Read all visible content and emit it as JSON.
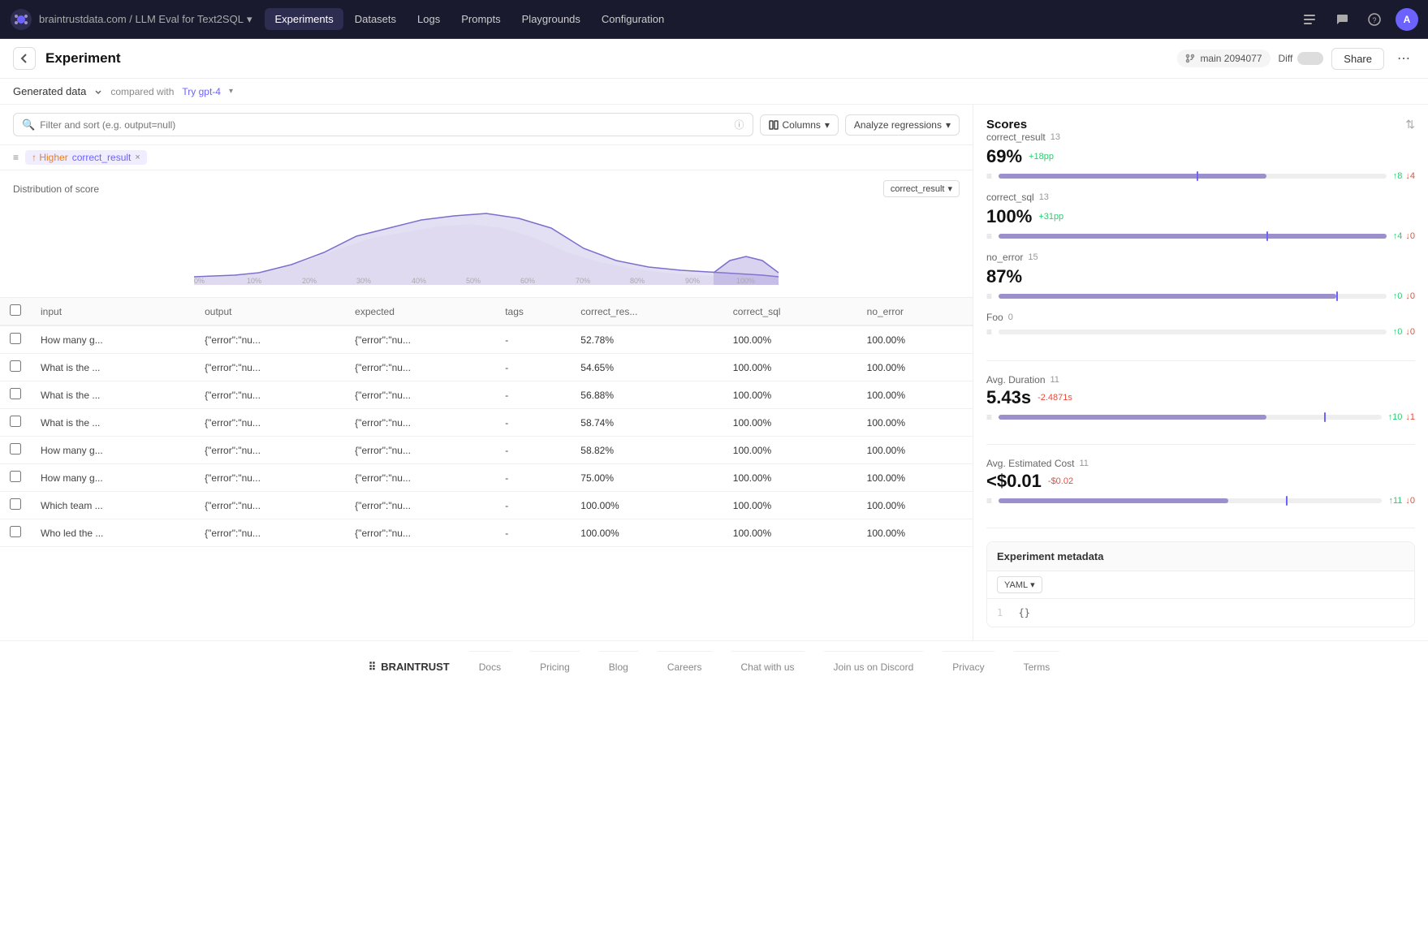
{
  "nav": {
    "logo_text": "B",
    "breadcrumb": "braintrustdata.com / LLM Eval for Text2SQL",
    "items": [
      {
        "label": "Experiments",
        "active": true
      },
      {
        "label": "Datasets",
        "active": false
      },
      {
        "label": "Logs",
        "active": false
      },
      {
        "label": "Prompts",
        "active": false
      },
      {
        "label": "Playgrounds",
        "active": false
      },
      {
        "label": "Configuration",
        "active": false
      }
    ]
  },
  "page": {
    "title": "Experiment",
    "back_label": "←",
    "data_label": "Generated data",
    "compared_with_label": "compared with",
    "compared_link": "Try gpt-4",
    "branch": "main 2094077",
    "diff_label": "Diff",
    "share_label": "Share",
    "more_label": "⋯"
  },
  "filters": {
    "search_placeholder": "Filter and sort (e.g. output=null)",
    "columns_label": "Columns",
    "analyze_label": "Analyze regressions",
    "active_filter": "Higher correct_result",
    "filter_icon": "≡"
  },
  "chart": {
    "title": "Distribution of score",
    "metric_label": "correct_result",
    "x_labels": [
      "0%",
      "10%",
      "20%",
      "30%",
      "40%",
      "50%",
      "60%",
      "70%",
      "80%",
      "90%",
      "100%"
    ]
  },
  "table": {
    "columns": [
      "input",
      "output",
      "expected",
      "tags",
      "correct_res...",
      "correct_sql",
      "no_error"
    ],
    "rows": [
      {
        "input": "How many g...",
        "output": "{\"error\":\"nu...",
        "expected": "{\"error\":\"nu...",
        "tags": "-",
        "correct_result": "52.78%",
        "correct_sql": "100.00%",
        "no_error": "100.00%"
      },
      {
        "input": "What is the ...",
        "output": "{\"error\":\"nu...",
        "expected": "{\"error\":\"nu...",
        "tags": "-",
        "correct_result": "54.65%",
        "correct_sql": "100.00%",
        "no_error": "100.00%"
      },
      {
        "input": "What is the ...",
        "output": "{\"error\":\"nu...",
        "expected": "{\"error\":\"nu...",
        "tags": "-",
        "correct_result": "56.88%",
        "correct_sql": "100.00%",
        "no_error": "100.00%"
      },
      {
        "input": "What is the ...",
        "output": "{\"error\":\"nu...",
        "expected": "{\"error\":\"nu...",
        "tags": "-",
        "correct_result": "58.74%",
        "correct_sql": "100.00%",
        "no_error": "100.00%"
      },
      {
        "input": "How many g...",
        "output": "{\"error\":\"nu...",
        "expected": "{\"error\":\"nu...",
        "tags": "-",
        "correct_result": "58.82%",
        "correct_sql": "100.00%",
        "no_error": "100.00%"
      },
      {
        "input": "How many g...",
        "output": "{\"error\":\"nu...",
        "expected": "{\"error\":\"nu...",
        "tags": "-",
        "correct_result": "75.00%",
        "correct_sql": "100.00%",
        "no_error": "100.00%"
      },
      {
        "input": "Which team ...",
        "output": "{\"error\":\"nu...",
        "expected": "{\"error\":\"nu...",
        "tags": "-",
        "correct_result": "100.00%",
        "correct_sql": "100.00%",
        "no_error": "100.00%"
      },
      {
        "input": "Who led the ...",
        "output": "{\"error\":\"nu...",
        "expected": "{\"error\":\"nu...",
        "tags": "-",
        "correct_result": "100.00%",
        "correct_sql": "100.00%",
        "no_error": "100.00%"
      }
    ]
  },
  "scores": {
    "section_title": "Scores",
    "items": [
      {
        "name": "correct_result",
        "count": "13",
        "value": "69%",
        "delta": "+18pp",
        "delta_type": "pos",
        "bar_fill_pct": 69,
        "bar_marker_pct": 51,
        "arrow_up": "↑8",
        "arrow_down": "↓4"
      },
      {
        "name": "correct_sql",
        "count": "13",
        "value": "100%",
        "delta": "+31pp",
        "delta_type": "pos",
        "bar_fill_pct": 100,
        "bar_marker_pct": 69,
        "arrow_up": "↑4",
        "arrow_down": "↓0"
      },
      {
        "name": "no_error",
        "count": "15",
        "value": "87%",
        "delta": "",
        "delta_type": "none",
        "bar_fill_pct": 87,
        "bar_marker_pct": 87,
        "arrow_up": "↑0",
        "arrow_down": "↓0"
      },
      {
        "name": "Foo",
        "count": "0",
        "value": "",
        "delta": "",
        "delta_type": "none",
        "bar_fill_pct": 0,
        "bar_marker_pct": 0,
        "arrow_up": "↑0",
        "arrow_down": "↓0"
      }
    ]
  },
  "avg_duration": {
    "label": "Avg. Duration",
    "count": "11",
    "value": "5.43s",
    "delta": "-2.4871s",
    "arrow_up": "↑10",
    "arrow_down": "↓1"
  },
  "avg_cost": {
    "label": "Avg. Estimated Cost",
    "count": "11",
    "value": "<$0.01",
    "delta": "-$0.02",
    "arrow_up": "↑11",
    "arrow_down": "↓0"
  },
  "metadata": {
    "section_title": "Experiment metadata",
    "format_label": "YAML",
    "line1_num": "1",
    "line1_content": "{}"
  },
  "footer": {
    "logo": "⠿ BRAINTRUST",
    "links": [
      "Docs",
      "Pricing",
      "Blog",
      "Careers",
      "Chat with us",
      "Join us on Discord",
      "Privacy",
      "Terms"
    ]
  }
}
